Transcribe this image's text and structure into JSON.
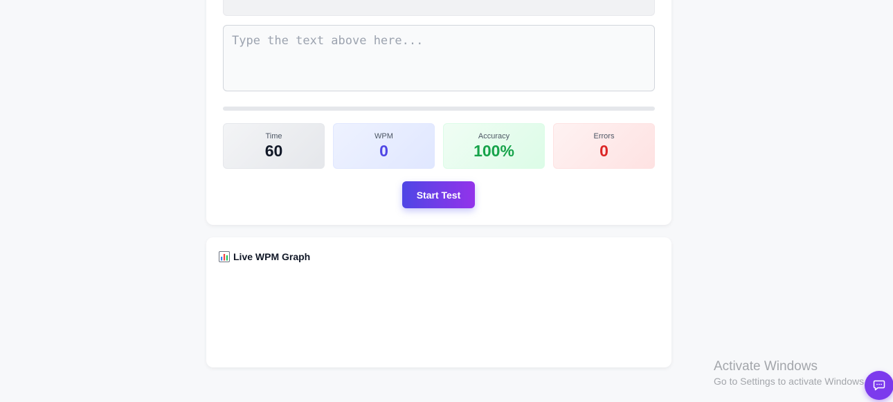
{
  "typing_area": {
    "passage_text": "",
    "input_value": "",
    "placeholder": "Type the text above here..."
  },
  "progress": {
    "percent": 0
  },
  "stats": {
    "time": {
      "label": "Time",
      "value": "60"
    },
    "wpm": {
      "label": "WPM",
      "value": "0"
    },
    "accuracy": {
      "label": "Accuracy",
      "value": "100%"
    },
    "errors": {
      "label": "Errors",
      "value": "0"
    }
  },
  "actions": {
    "start_label": "Start Test"
  },
  "graph": {
    "title": "Live WPM Graph",
    "icon": "bar-chart-icon"
  },
  "watermark": {
    "title": "Activate Windows",
    "subtitle": "Go to Settings to activate Windows."
  },
  "chat": {
    "icon": "chat-bubble-icon"
  },
  "colors": {
    "accent": "#4f46e5",
    "accent_end": "#9333ea",
    "success": "#16a34a",
    "danger": "#dc2626"
  }
}
